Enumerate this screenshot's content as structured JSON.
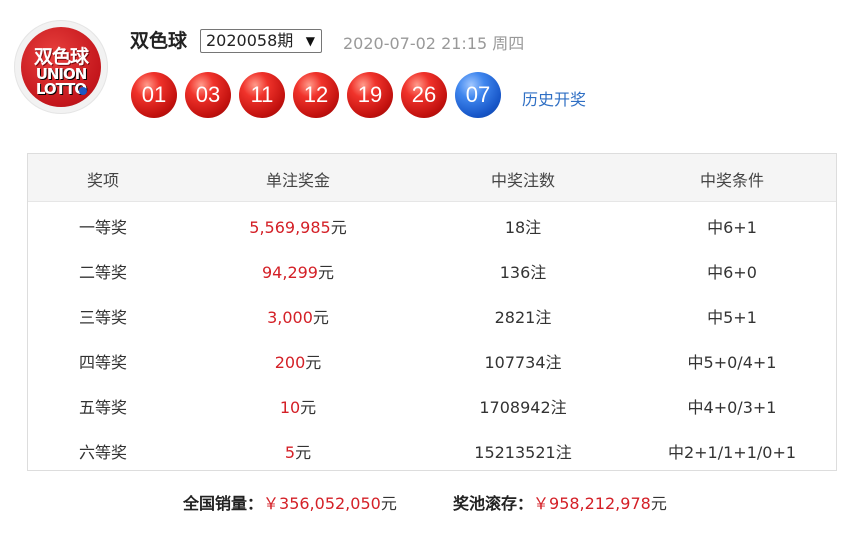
{
  "header": {
    "logo_text_top": "双色球",
    "logo_text_bottom": "UNION LOTTO",
    "game_title": "双色球",
    "issue_selected": "2020058期",
    "draw_datetime": "2020-07-02 21:15 周四",
    "history_link": "历史开奖"
  },
  "balls": {
    "red": [
      "01",
      "03",
      "11",
      "12",
      "19",
      "26"
    ],
    "blue": [
      "07"
    ],
    "colors": {
      "red": "#e0241f",
      "blue": "#1f63d6"
    }
  },
  "table": {
    "headers": [
      "奖项",
      "单注奖金",
      "中奖注数",
      "中奖条件"
    ],
    "rows": [
      {
        "level": "一等奖",
        "amount": "5,569,985",
        "unit": "元",
        "count": "18注",
        "condition": "中6+1"
      },
      {
        "level": "二等奖",
        "amount": "94,299",
        "unit": "元",
        "count": "136注",
        "condition": "中6+0"
      },
      {
        "level": "三等奖",
        "amount": "3,000",
        "unit": "元",
        "count": "2821注",
        "condition": "中5+1"
      },
      {
        "level": "四等奖",
        "amount": "200",
        "unit": "元",
        "count": "107734注",
        "condition": "中5+0/4+1"
      },
      {
        "level": "五等奖",
        "amount": "10",
        "unit": "元",
        "count": "1708942注",
        "condition": "中4+0/3+1"
      },
      {
        "level": "六等奖",
        "amount": "5",
        "unit": "元",
        "count": "15213521注",
        "condition": "中2+1/1+1/0+1"
      }
    ]
  },
  "footer": {
    "sales_label": "全国销量：",
    "sales_value": "￥356,052,050",
    "sales_unit": "元",
    "pool_label": "奖池滚存：",
    "pool_value": "￥958,212,978",
    "pool_unit": "元"
  },
  "accent_colors": {
    "money": "#d42027",
    "link": "#2f6fc4"
  }
}
